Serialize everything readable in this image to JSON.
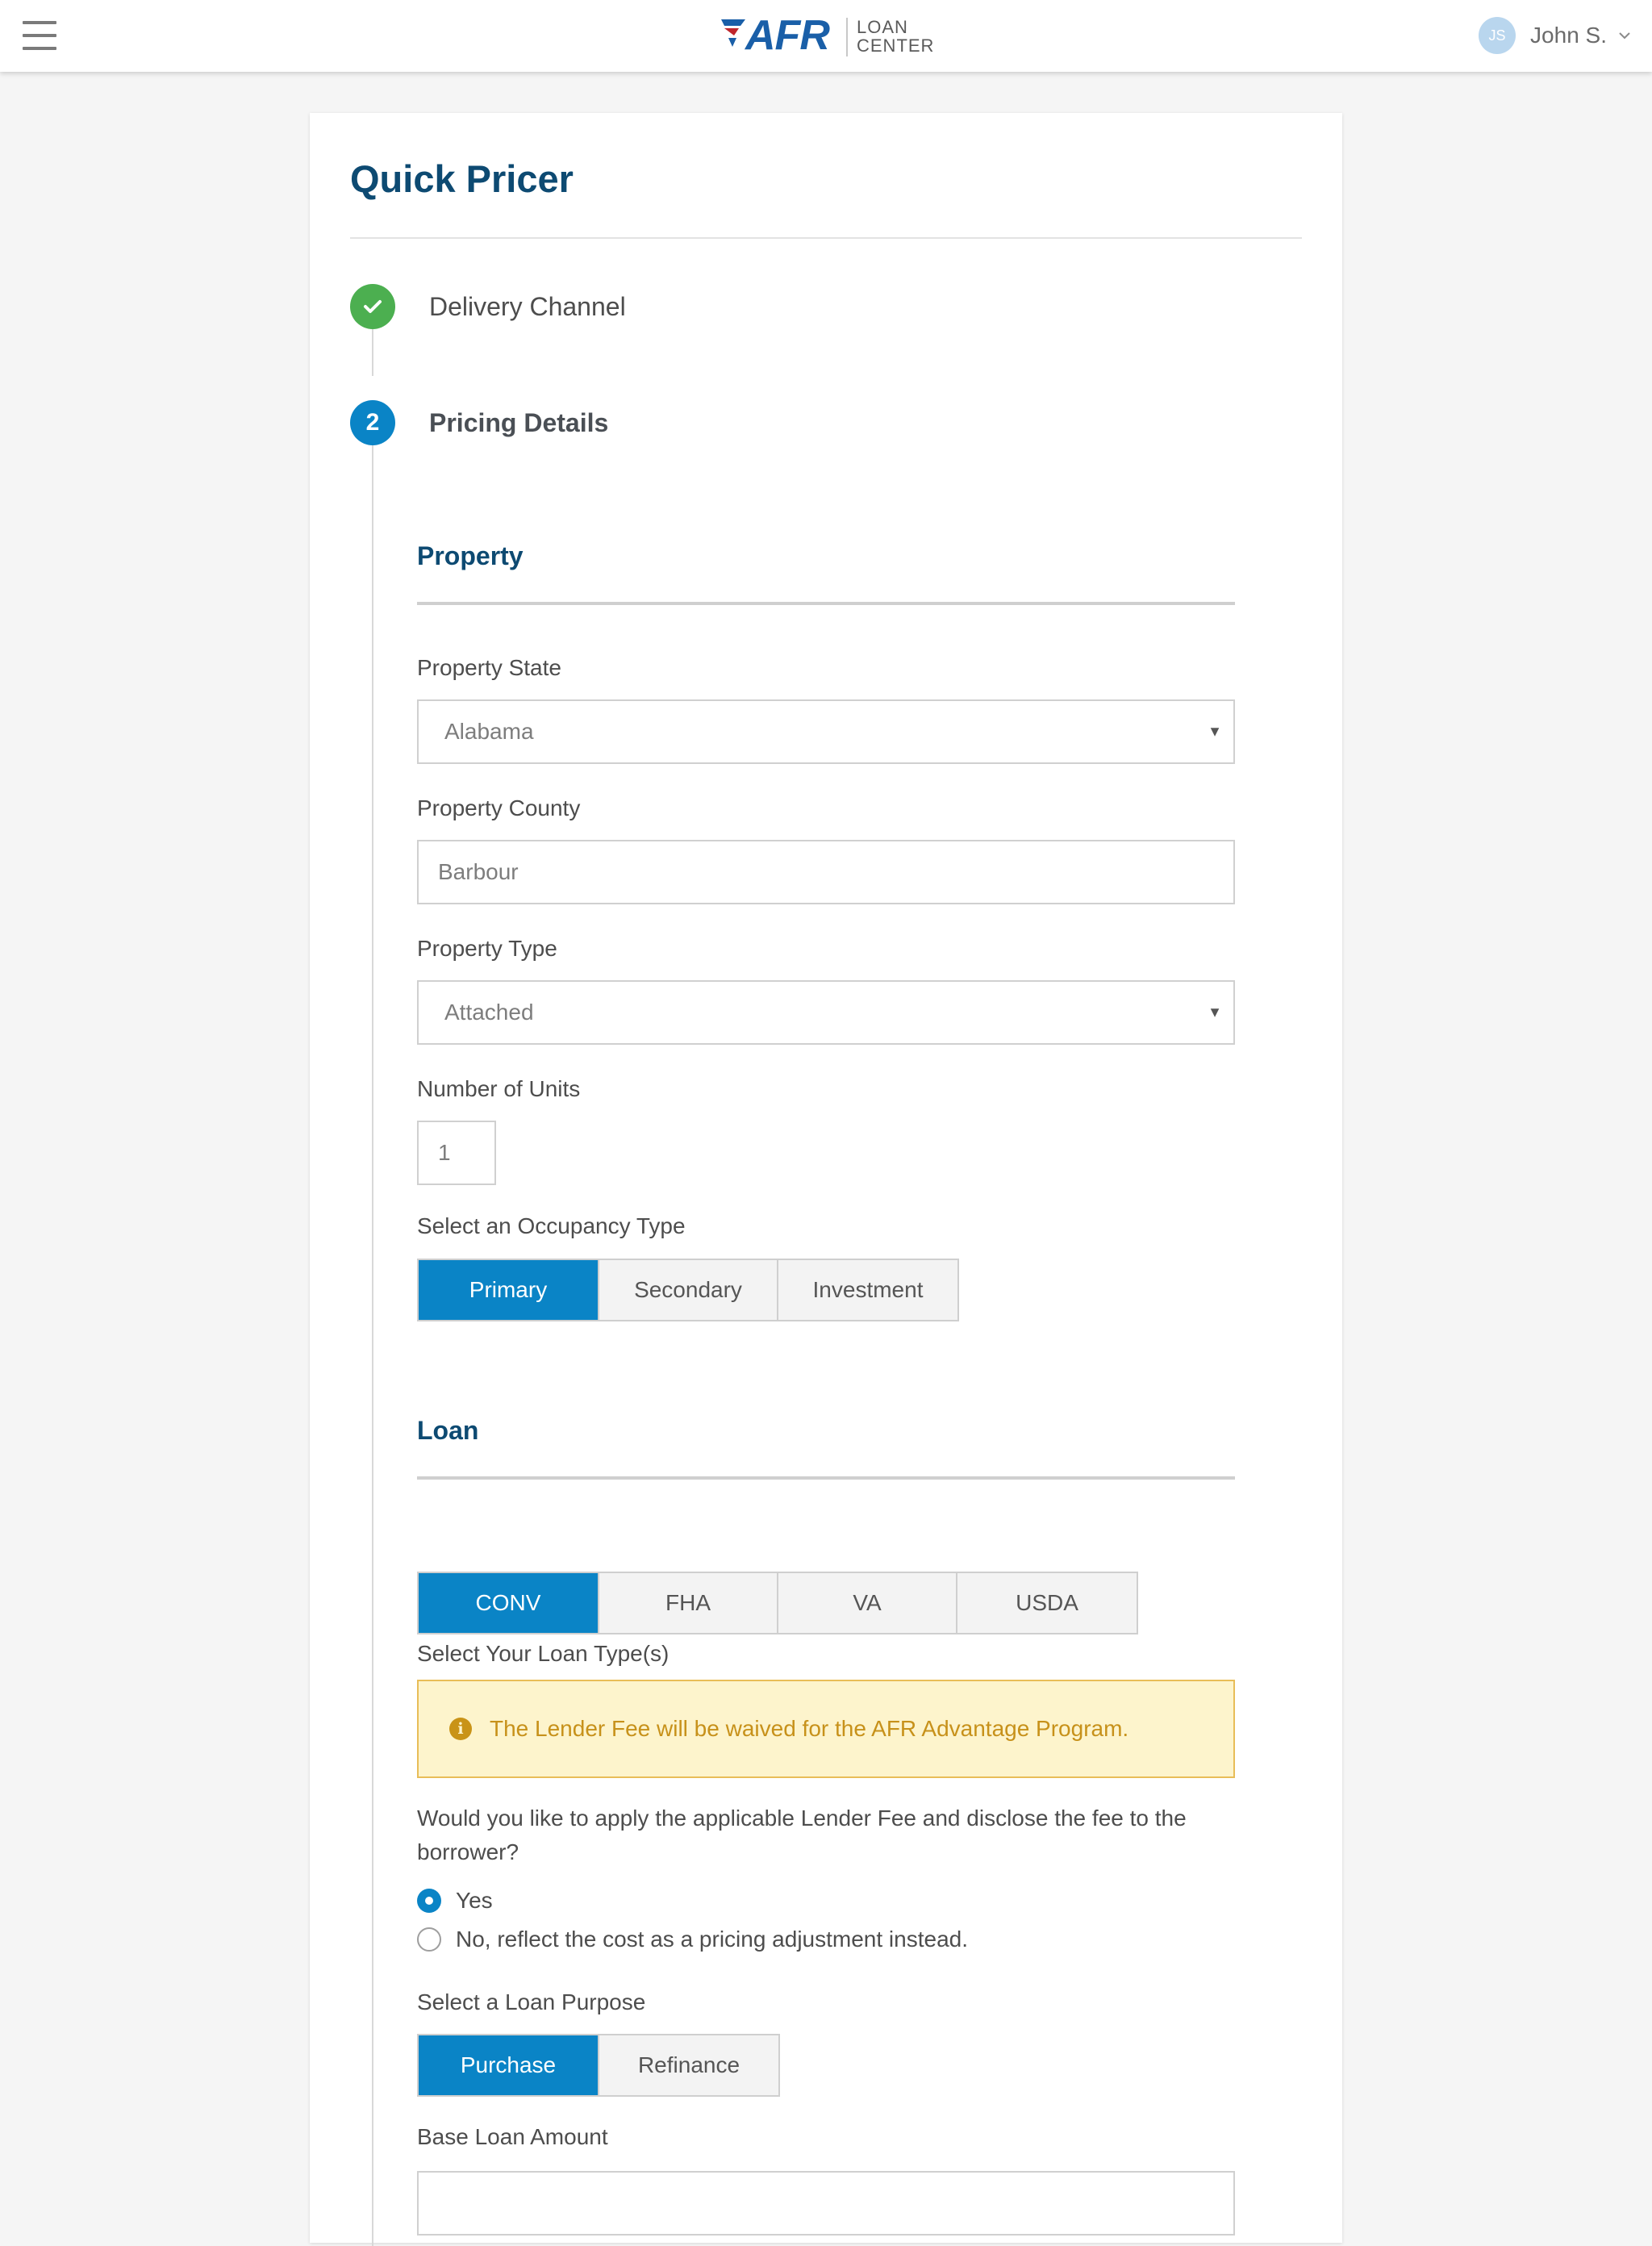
{
  "header": {
    "brand_name": "AFR",
    "brand_sub_line1": "LOAN",
    "brand_sub_line2": "CENTER",
    "user_initials": "JS",
    "user_name": "John S."
  },
  "page": {
    "title": "Quick Pricer"
  },
  "steps": [
    {
      "label": "Delivery Channel",
      "status": "complete"
    },
    {
      "number": "2",
      "label": "Pricing Details",
      "status": "active"
    }
  ],
  "property": {
    "section_title": "Property",
    "state_label": "Property State",
    "state_value": "Alabama",
    "county_label": "Property County",
    "county_value": "Barbour",
    "type_label": "Property Type",
    "type_value": "Attached",
    "units_label": "Number of Units",
    "units_value": "1",
    "occupancy_label": "Select an Occupancy Type",
    "occupancy_options": [
      "Primary",
      "Secondary",
      "Investment"
    ],
    "occupancy_selected": "Primary"
  },
  "loan": {
    "section_title": "Loan",
    "type_label": "Select Your Loan Type(s)",
    "type_options": [
      "CONV",
      "FHA",
      "VA",
      "USDA"
    ],
    "type_selected": "CONV",
    "notice_text": "The Lender Fee will be waived for the AFR Advantage Program.",
    "fee_question": "Would you like to apply the applicable Lender Fee and disclose the fee to the borrower?",
    "fee_options": [
      "Yes",
      "No, reflect the cost as a pricing adjustment instead."
    ],
    "fee_selected": "Yes",
    "purpose_label": "Select a Loan Purpose",
    "purpose_options": [
      "Purchase",
      "Refinance"
    ],
    "purpose_selected": "Purchase",
    "amount_label": "Base Loan Amount",
    "amount_value": ""
  },
  "colors": {
    "primary": "#0a84c6",
    "heading": "#0d4a72",
    "success": "#4caf50",
    "notice_bg": "#fdf4cc",
    "notice_text": "#c7911a"
  },
  "icons": {
    "menu": "hamburger-icon",
    "logo": "afr-logo",
    "user_menu": "chevron-down-icon",
    "step_done": "check-icon",
    "select": "caret-down-icon",
    "notice": "info-icon"
  }
}
